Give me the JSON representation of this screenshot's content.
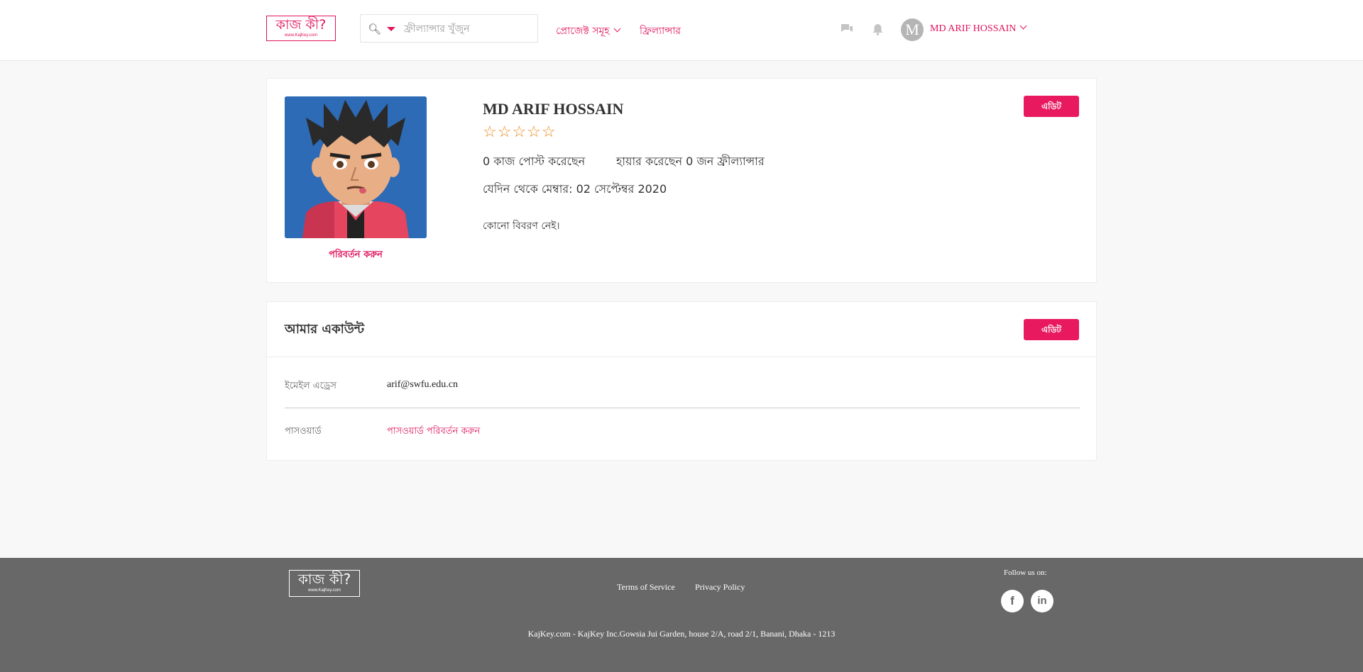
{
  "colors": {
    "accent": "#e0135c",
    "button": "#e8195f",
    "star": "#ef8a1e",
    "footer_bg": "#686868"
  },
  "header": {
    "logo_text": "কাজ কী?",
    "logo_sub": "www.KajKey.com",
    "search": {
      "placeholder": "ফ্রীল্যান্সার খুঁজুন",
      "icon": "search-icon"
    },
    "nav": {
      "projects": "প্রোজেক্ট সমূহ",
      "freelancer": "ফ্রিল্যান্সার"
    },
    "icons": [
      "chat-icon",
      "bell-icon"
    ],
    "avatar_letter": "M",
    "user_name": "MD ARIF HOSSAIN"
  },
  "profile": {
    "name": "MD ARIF HOSSAIN",
    "stars": "☆☆☆☆☆",
    "rating": 0,
    "jobs_posted": "0 কাজ পোস্ট করেছেন",
    "hired": "হায়ার করেছেন 0 জন ফ্রীল্যান্সার",
    "member_since": "যেদিন থেকে মেম্বার: 02 সেপ্টেম্বর 2020",
    "description": "কোনো বিবরণ নেই।",
    "change_photo": "পরিবর্তন করুন",
    "edit_label": "এডিট"
  },
  "account": {
    "title": "আমার একাউন্ট",
    "edit_label": "এডিট",
    "email_label": "ইমেইল এড্রেস",
    "email_value": "arif@swfu.edu.cn",
    "password_label": "পাসওয়ার্ড",
    "password_link": "পাসওয়ার্ড পরিবর্তন করুন"
  },
  "footer": {
    "logo_text": "কাজ কী?",
    "logo_sub": "www.KajKey.com",
    "terms": "Terms of Service",
    "privacy": "Privacy Policy",
    "follow": "Follow us on:",
    "social": [
      "facebook-icon",
      "linkedin-icon"
    ],
    "address": "KajKey.com - KajKey Inc.Gowsia Jui Garden, house 2/A, road 2/1, Banani, Dhaka - 1213"
  }
}
